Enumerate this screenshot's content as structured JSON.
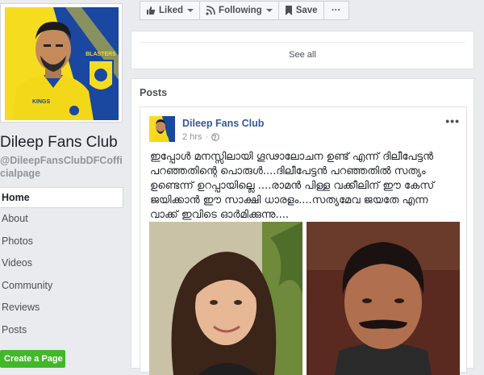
{
  "sidebar": {
    "page_name": "Dileep Fans Club",
    "handle": "@DileepFansClubDFCofficialpage",
    "nav": [
      "Home",
      "About",
      "Photos",
      "Videos",
      "Community",
      "Reviews",
      "Posts"
    ],
    "create_page": "Create a Page",
    "profile_pic_text": [
      "BLASTERS",
      "KINGS"
    ]
  },
  "action_bar": {
    "liked": "Liked",
    "following": "Following",
    "save": "Save",
    "more": "···"
  },
  "see_all": "See all",
  "posts": {
    "title": "Posts",
    "author": "Dileep Fans Club",
    "time": "2 hrs",
    "text": "ഇപ്പോൾ മനസ്സിലായി ഗൂഢാലോചന ഉണ്ട് എന്ന് ദിലീപേട്ടൻ പറഞ്ഞതിന്റെ പൊരുൾ....ദിലീപേട്ടൻ പറഞ്ഞതിൽ സത്യം ഉണ്ടെന്ന് ഉറപ്പായില്ലെ ....രാമൻ പിള്ള വക്കീലിന് ഈ കേസ് ജയിക്കാൻ ഈ സാക്ഷി ധാരളം....സത്യമേവ ജയതേ എന്ന വാക്ക് ഇവിടെ ഓർമിക്കുന്നു...."
  },
  "colors": {
    "background": "#e9ebee",
    "link": "#365899",
    "create_page_green": "#42b72a",
    "jersey_yellow": "#f5dc1f"
  }
}
